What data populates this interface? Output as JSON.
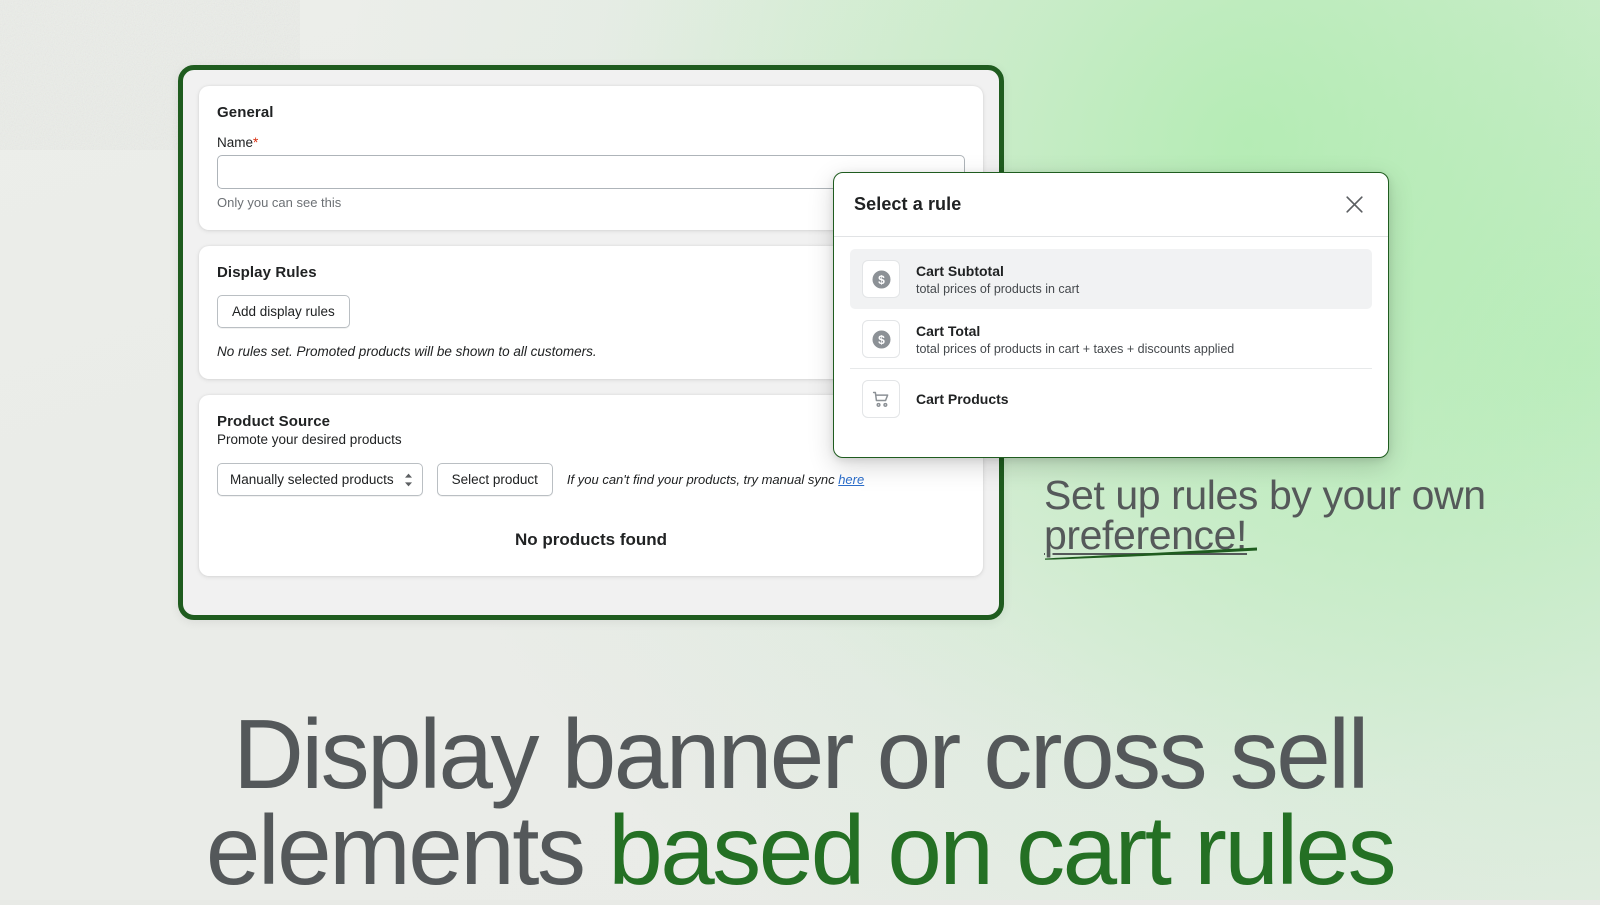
{
  "theme": {
    "frame_border": "#1f5c1f",
    "accent_green": "#247024",
    "headline_gray": "#54585a",
    "link_blue": "#2c6ecb",
    "required_red": "#d82c0d",
    "page_bg": "#f1f1f1"
  },
  "app": {
    "general": {
      "title": "General",
      "name_label": "Name",
      "required_marker": "*",
      "name_value": "",
      "name_placeholder": "",
      "help_text": "Only you can see this"
    },
    "display_rules": {
      "title": "Display Rules",
      "add_button": "Add display rules",
      "empty_note": "No rules set. Promoted products will be shown to all customers."
    },
    "product_source": {
      "title": "Product Source",
      "subtitle": "Promote your desired products",
      "select_value": "Manually selected products",
      "select_options": [
        "Manually selected products"
      ],
      "select_product_button": "Select product",
      "sync_note_prefix": "If you can't find your products, try manual sync ",
      "sync_link": "here",
      "empty_state": "No products found"
    }
  },
  "modal": {
    "title": "Select a rule",
    "close_icon": "close-icon",
    "rules": [
      {
        "name": "Cart Subtotal",
        "description": "total prices of products in cart",
        "icon": "dollar-coin-icon",
        "selected": true
      },
      {
        "name": "Cart Total",
        "description": "total prices of products in cart + taxes + discounts applied",
        "icon": "dollar-coin-icon",
        "selected": false
      },
      {
        "name": "Cart Products",
        "description": "",
        "icon": "shopping-cart-icon",
        "selected": false
      }
    ]
  },
  "marketing": {
    "sub_headline_lead": "Set up rules by your own ",
    "sub_headline_emphasis": "preference!",
    "headline_line1": "Display banner or cross sell",
    "headline_line2_gray": "elements ",
    "headline_line2_green": "based on cart rules"
  }
}
